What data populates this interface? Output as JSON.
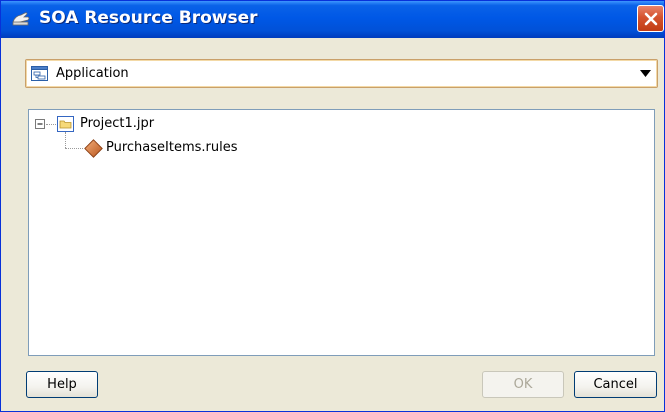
{
  "window": {
    "title": "SOA Resource Browser",
    "title_icon": "soa-hand-icon",
    "close_icon": "close-icon",
    "colors": {
      "titlebar": "#0058e6",
      "body": "#ece9d8",
      "close": "#d5532e"
    }
  },
  "location_combo": {
    "selected": "Application",
    "icon": "application-icon",
    "arrow_icon": "dropdown-arrow-icon"
  },
  "tree": {
    "nodes": [
      {
        "label": "Project1.jpr",
        "icon": "folder-icon",
        "expanded": true,
        "expander_icon": "collapse-minus-icon"
      },
      {
        "label": "PurchaseItems.rules",
        "icon": "rules-diamond-icon",
        "parent": "Project1.jpr"
      }
    ]
  },
  "buttons": {
    "help": "Help",
    "ok": "OK",
    "cancel": "Cancel"
  }
}
